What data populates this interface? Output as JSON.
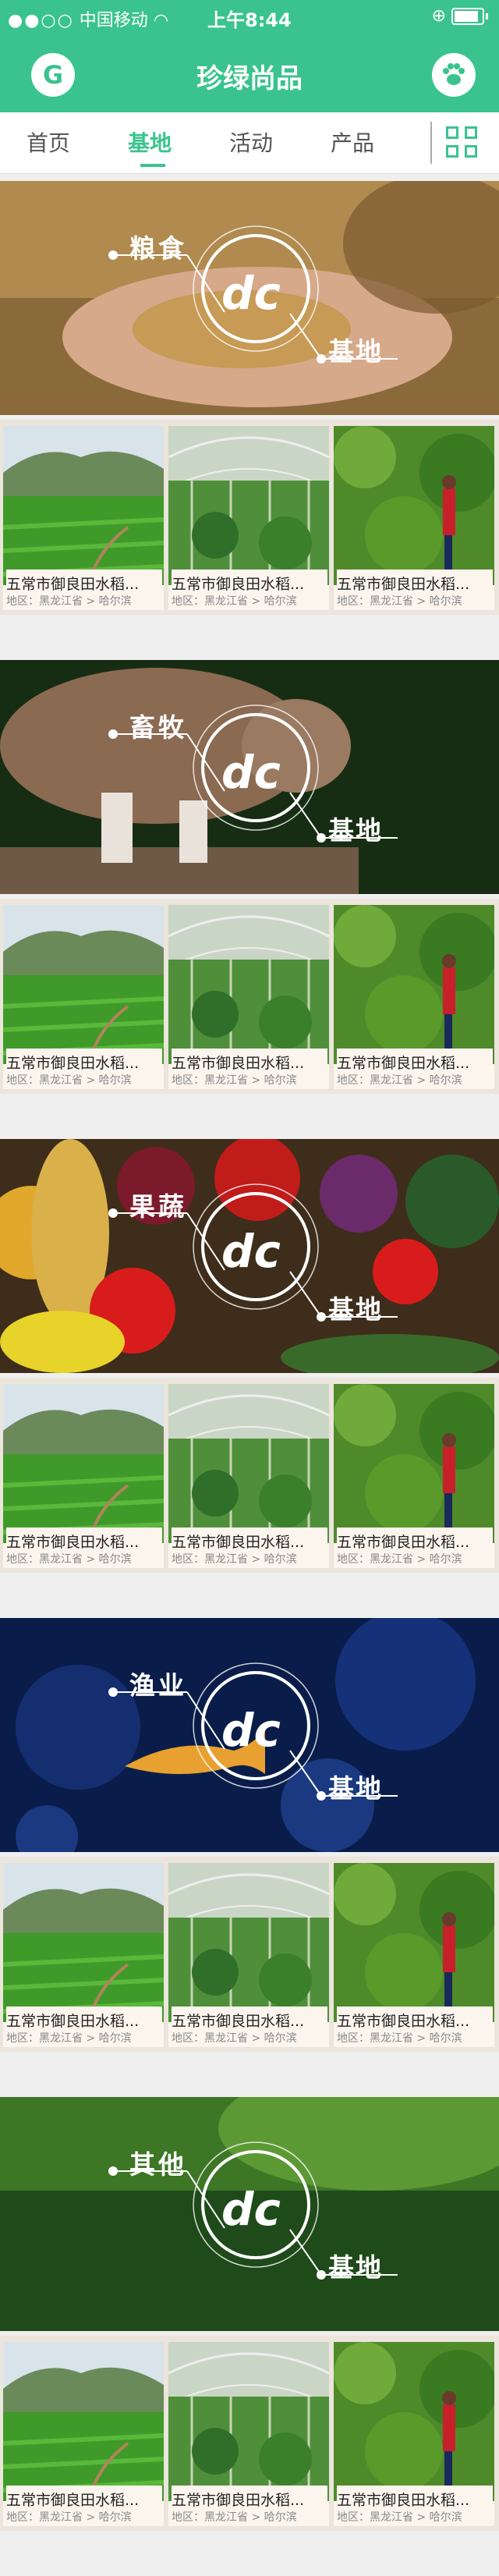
{
  "status": {
    "carrier": "中国移动",
    "time": "上午8:44"
  },
  "header": {
    "title": "珍绿尚品",
    "logo_letter": "G"
  },
  "tabs": [
    {
      "label": "首页"
    },
    {
      "label": "基地",
      "active": true
    },
    {
      "label": "活动"
    },
    {
      "label": "产品"
    }
  ],
  "sections": [
    {
      "category": "粮食",
      "base": "基地",
      "mark": "dc",
      "theme": "grain"
    },
    {
      "category": "畜牧",
      "base": "基地",
      "mark": "dc",
      "theme": "livestock"
    },
    {
      "category": "果蔬",
      "base": "基地",
      "mark": "dc",
      "theme": "produce"
    },
    {
      "category": "渔业",
      "base": "基地",
      "mark": "dc",
      "theme": "fishery"
    },
    {
      "category": "其他",
      "base": "基地",
      "mark": "dc",
      "theme": "other"
    }
  ],
  "card": {
    "names": [
      "五常市御良田水稻...",
      "五常市御良田水稻...",
      "五常市御良田水稻..."
    ],
    "region": "地区：黑龙江省 > 哈尔滨"
  },
  "colors": {
    "brand": "#3ac38e",
    "card_bg": "#fbf5ee"
  }
}
